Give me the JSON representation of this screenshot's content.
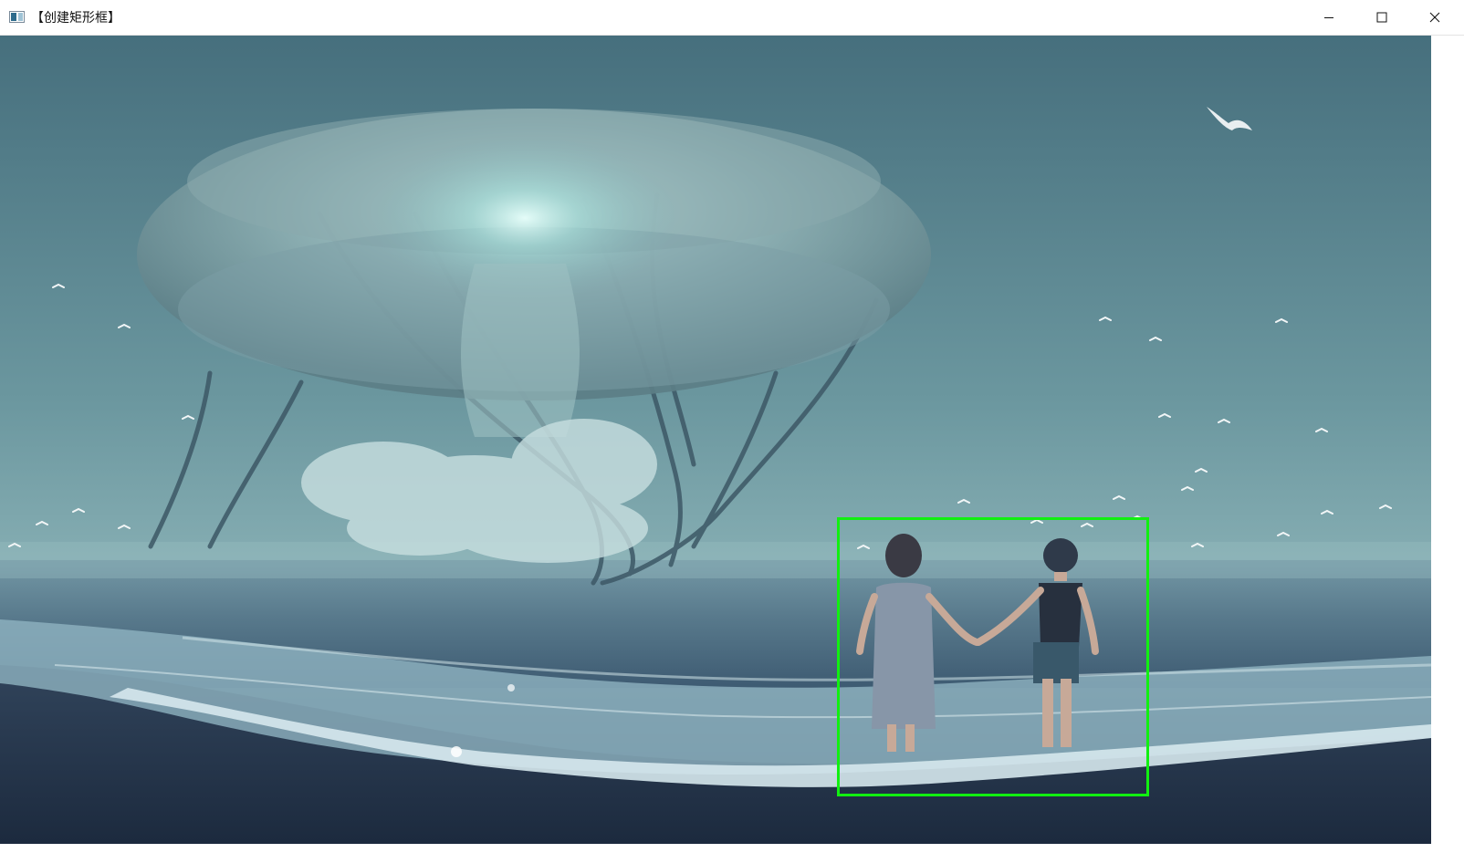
{
  "window": {
    "title": "【创建矩形框】",
    "controls": {
      "minimize": "minimize-icon",
      "maximize": "maximize-icon",
      "close": "close-icon"
    }
  },
  "image": {
    "subject": "jellyfish-beach-scene",
    "colors": {
      "sky": "#5f8c97",
      "sea": "#3b5870",
      "sand": "#24344b",
      "foam": "#c7dde4"
    }
  },
  "selection_rectangle": {
    "color": "#11f011"
  }
}
